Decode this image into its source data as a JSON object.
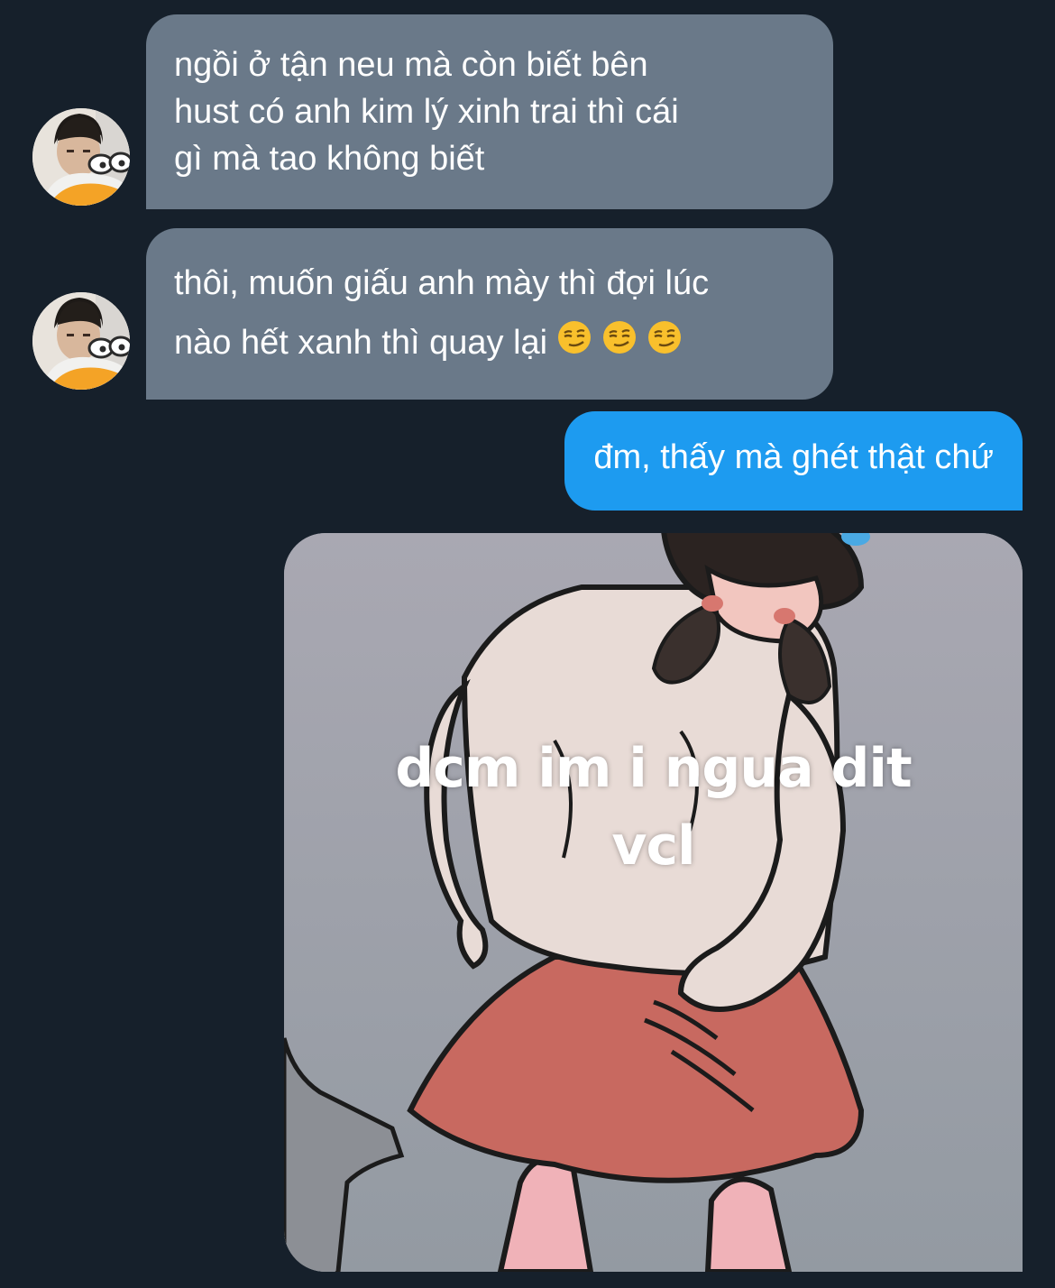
{
  "messages": {
    "incoming_1": {
      "lines": [
        "ngồi ở tận neu mà còn biết bên",
        "hust có anh kim lý xinh trai thì cái",
        "gì mà tao không biết"
      ]
    },
    "incoming_2": {
      "lines": [
        "thôi, muốn giấu anh mày thì đợi lúc",
        "nào hết xanh thì quay lại"
      ],
      "emoji": [
        "smirking-face-icon",
        "smirking-face-icon",
        "smirking-face-icon"
      ]
    },
    "outgoing_1": {
      "text": "đm, thấy mà ghét thật chứ"
    },
    "outgoing_media": {
      "caption_lines": [
        "dcm im i ngua dit",
        "vcl"
      ]
    }
  },
  "colors": {
    "background": "#16202b",
    "incoming_bubble": "#6a7989",
    "outgoing_bubble": "#1d9bf0",
    "text": "#ffffff"
  }
}
